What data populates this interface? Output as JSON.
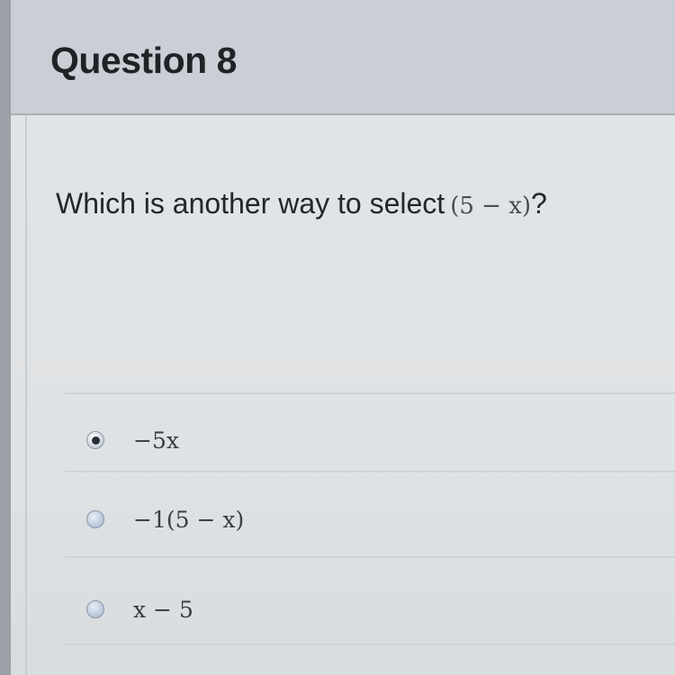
{
  "header": {
    "title": "Question 8"
  },
  "question": {
    "prompt": "Which is another way to select",
    "expression": "(5 − x)",
    "question_mark": "?"
  },
  "options": [
    {
      "label": "−5x",
      "selected": true
    },
    {
      "label": "−1(5 − x)",
      "selected": false
    },
    {
      "label": "x − 5",
      "selected": false
    }
  ],
  "colors": {
    "header_bg": "#c9cfd5",
    "body_bg": "#e1e4e6",
    "text": "#23262a"
  }
}
